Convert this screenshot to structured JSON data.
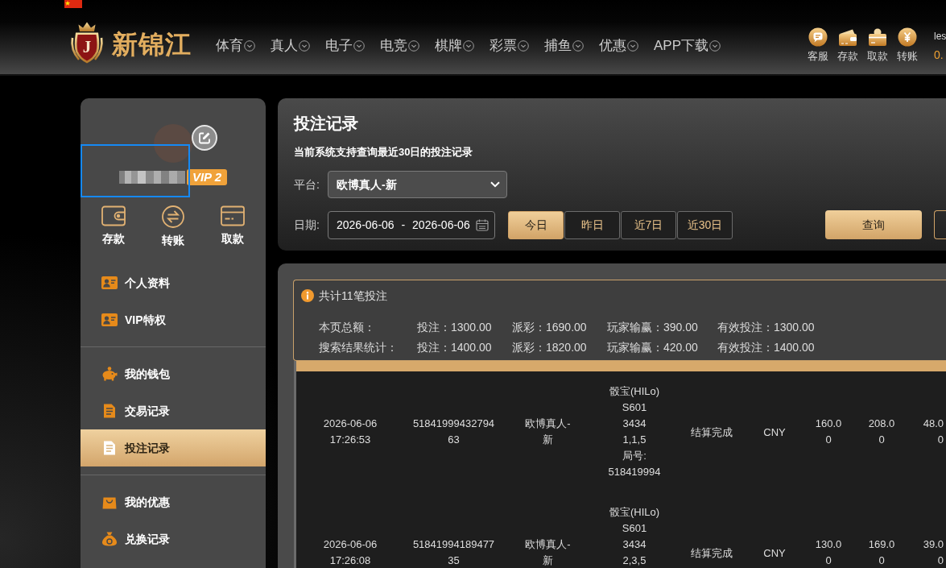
{
  "header": {
    "logo": {
      "letter": "J",
      "name": "新锦江"
    },
    "nav": [
      "体育",
      "真人",
      "电子",
      "电竞",
      "棋牌",
      "彩票",
      "捕鱼",
      "优惠",
      "APP下载"
    ],
    "quick_links": [
      "客服",
      "存款",
      "取款",
      "转账"
    ],
    "user": {
      "name": "les",
      "balance": "0."
    }
  },
  "sidebar": {
    "vip_badge": "VIP 2",
    "actions": [
      "存款",
      "转账",
      "取款"
    ],
    "menu_sections": [
      {
        "items": [
          {
            "label": "个人资料",
            "selected": false
          },
          {
            "label": "VIP特权",
            "selected": false
          }
        ]
      },
      {
        "items": [
          {
            "label": "我的钱包",
            "selected": false
          },
          {
            "label": "交易记录",
            "selected": false
          },
          {
            "label": "投注记录",
            "selected": true
          }
        ]
      },
      {
        "items": [
          {
            "label": "我的优惠",
            "selected": false
          },
          {
            "label": "兑换记录",
            "selected": false
          }
        ]
      }
    ]
  },
  "query_panel": {
    "title": "投注记录",
    "note": "当前系统支持查询最近30日的投注记录",
    "platform": {
      "label": "平台:",
      "value": "欧博真人-新"
    },
    "date": {
      "label": "日期:",
      "value": "2026-06-06 - 2026-06-06"
    },
    "ranges": [
      {
        "label": "今日",
        "selected": true
      },
      {
        "label": "昨日",
        "selected": false
      },
      {
        "label": "近7日",
        "selected": false
      },
      {
        "label": "近30日",
        "selected": false
      }
    ],
    "submit": "查询"
  },
  "summary": {
    "total": "共计11笔投注",
    "rows": [
      {
        "label": "本页总额：",
        "values": [
          "投注：1300.00",
          "派彩：1690.00",
          "玩家输赢：390.00",
          "有效投注：1300.00"
        ]
      },
      {
        "label": "搜索结果统计：",
        "values": [
          "投注：1400.00",
          "派彩：1820.00",
          "玩家输赢：420.00",
          "有效投注：1400.00"
        ]
      }
    ]
  },
  "table": {
    "rows": [
      {
        "cells": [
          "2026-06-06 17:26:53",
          "5184199943279463",
          "欧博真人-新",
          [
            "骰宝(HILo)",
            "S601",
            "3434",
            "1,1,5",
            "局号:",
            "518419994"
          ],
          "结算完成",
          "CNY",
          "160.00",
          "208.00",
          "48.00"
        ]
      },
      {
        "cells": [
          "2026-06-06 17:26:08",
          "5184199418947735",
          "欧博真人-新",
          [
            "骰宝(HILo)",
            "S601",
            "3434",
            "2,3,5"
          ],
          "结算完成",
          "CNY",
          "130.00",
          "169.00",
          "39.00"
        ]
      }
    ]
  }
}
